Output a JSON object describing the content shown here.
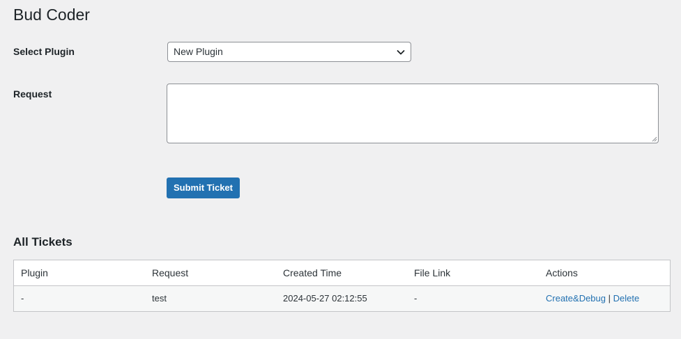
{
  "page": {
    "title": "Bud Coder"
  },
  "form": {
    "plugin_label": "Select Plugin",
    "plugin_selected": "New Plugin",
    "request_label": "Request",
    "request_value": "",
    "submit_label": "Submit Ticket"
  },
  "tickets": {
    "title": "All Tickets",
    "columns": [
      "Plugin",
      "Request",
      "Created Time",
      "File Link",
      "Actions"
    ],
    "rows": [
      {
        "plugin": "-",
        "request": "test",
        "created": "2024-05-27 02:12:55",
        "file_link": "-",
        "action_debug": "Create&Debug",
        "action_separator": "|",
        "action_delete": "Delete"
      }
    ]
  },
  "colors": {
    "background": "#f0f0f1",
    "primary": "#2271b1",
    "text": "#1d2327",
    "border": "#8c8f94"
  },
  "icons": {
    "select_chevron": "chevron-down-icon",
    "textarea_grip": "resize-grip-icon"
  }
}
